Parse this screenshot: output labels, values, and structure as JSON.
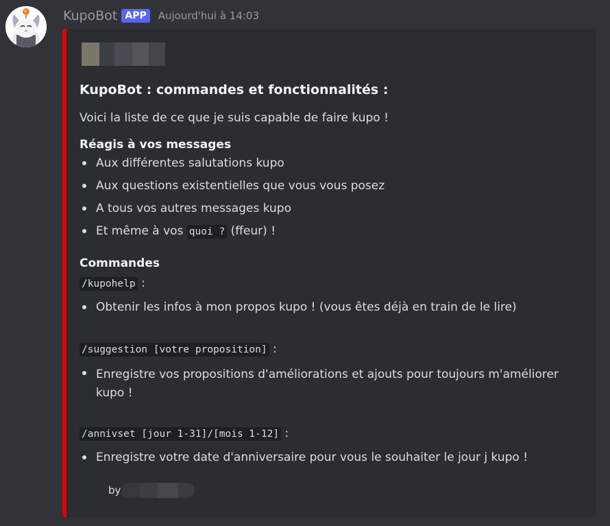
{
  "message": {
    "username": "KupoBot",
    "badge": "APP",
    "timestamp": "Aujourd'hui à 14:03"
  },
  "embed": {
    "accent_color": "#e30000",
    "title": "KupoBot : commandes et fonctionnalités :",
    "description": "Voici la liste de ce que je suis capable de faire kupo !",
    "section_react": {
      "title": "Réagis à vos messages",
      "items": [
        "Aux différentes salutations kupo",
        "Aux questions existentielles que vous vous posez",
        "A tous vos autres messages kupo"
      ],
      "last_item_prefix": "Et même à vos ",
      "last_item_code": "quoi ?",
      "last_item_suffix": " (ffeur) !"
    },
    "section_commands": {
      "title": "Commandes",
      "commands": [
        {
          "command": "/kupohelp",
          "suffix": " :",
          "description": "Obtenir les infos à mon propos kupo ! (vous êtes déjà en train de le lire)"
        },
        {
          "command": "/suggestion [votre proposition]",
          "suffix": " :",
          "description": "Enregistre vos propositions d'améliorations et ajouts pour toujours m'améliorer kupo !"
        },
        {
          "command": "/annivset [jour 1-31]/[mois 1-12]",
          "suffix": " :",
          "description": "Enregistre votre date d'anniversaire pour vous le souhaiter le jour j kupo !"
        }
      ]
    },
    "footer_prefix": "by"
  }
}
